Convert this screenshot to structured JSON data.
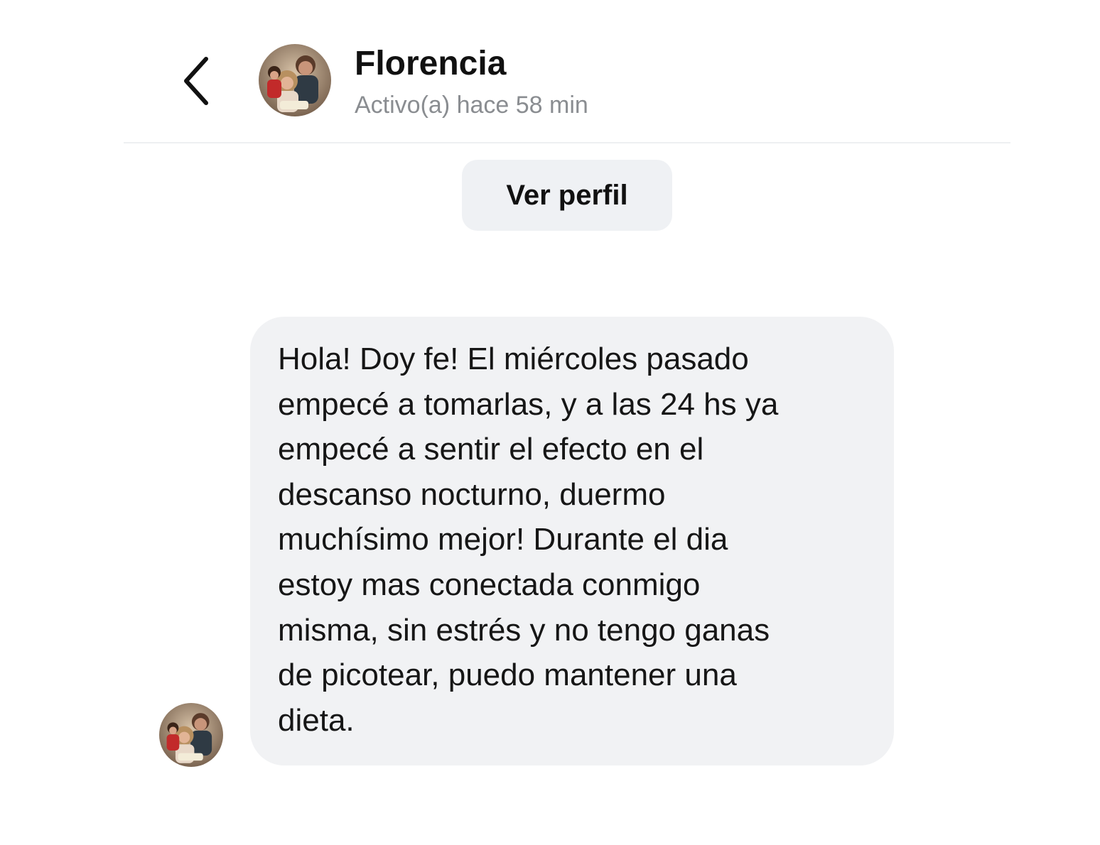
{
  "header": {
    "back_icon": "chevron-left-icon",
    "contact_name": "Florencia",
    "status": "Activo(a) hace 58 min"
  },
  "profile_button": {
    "label": "Ver perfil"
  },
  "message": {
    "lines": [
      "Hola! Doy fe! El miércoles pasado",
      "empecé a tomarlas, y a las 24 hs ya",
      "empecé a sentir el efecto en el",
      "descanso nocturno, duermo",
      "muchísimo mejor! Durante el dia",
      "estoy mas conectada conmigo",
      "misma, sin estrés y no tengo ganas",
      "de picotear, puedo mantener una",
      "dieta."
    ]
  },
  "colors": {
    "bubble_background": "#f1f2f4",
    "button_background": "#eff1f4",
    "status_text": "#8a8d91",
    "divider": "#eef0f2"
  }
}
